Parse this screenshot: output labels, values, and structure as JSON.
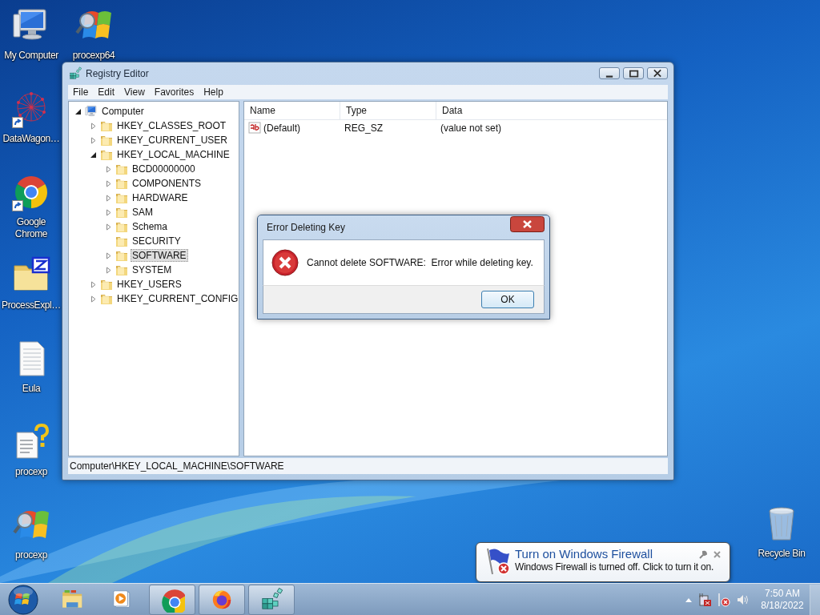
{
  "desktop_icons": [
    {
      "label": "My Computer",
      "kind": "computer",
      "shortcut": false
    },
    {
      "label": "DataWagon…",
      "kind": "network-graph",
      "shortcut": true
    },
    {
      "label": "Google Chrome",
      "kind": "chrome",
      "shortcut": true
    },
    {
      "label": "ProcessExpl…",
      "kind": "zip-folder",
      "shortcut": false
    },
    {
      "label": "Eula",
      "kind": "document",
      "shortcut": false
    },
    {
      "label": "procexp",
      "kind": "help-document",
      "shortcut": false
    },
    {
      "label": "procexp",
      "kind": "windows-magnifier",
      "shortcut": false
    },
    {
      "label": "procexp64",
      "kind": "windows-magnifier",
      "shortcut": false
    }
  ],
  "recycle_bin": {
    "label": "Recycle Bin"
  },
  "registry_editor": {
    "title": "Registry Editor",
    "menu": [
      "File",
      "Edit",
      "View",
      "Favorites",
      "Help"
    ],
    "tree": {
      "label": "Computer",
      "kind": "computer",
      "expandable": true,
      "expanded": true,
      "selected": false,
      "children": [
        {
          "label": "HKEY_CLASSES_ROOT",
          "kind": "folder",
          "expandable": true,
          "expanded": false,
          "selected": false
        },
        {
          "label": "HKEY_CURRENT_USER",
          "kind": "folder",
          "expandable": true,
          "expanded": false,
          "selected": false
        },
        {
          "label": "HKEY_LOCAL_MACHINE",
          "kind": "folder",
          "expandable": true,
          "expanded": true,
          "selected": false,
          "children": [
            {
              "label": "BCD00000000",
              "kind": "folder",
              "expandable": true,
              "expanded": false,
              "selected": false
            },
            {
              "label": "COMPONENTS",
              "kind": "folder",
              "expandable": true,
              "expanded": false,
              "selected": false
            },
            {
              "label": "HARDWARE",
              "kind": "folder",
              "expandable": true,
              "expanded": false,
              "selected": false
            },
            {
              "label": "SAM",
              "kind": "folder",
              "expandable": true,
              "expanded": false,
              "selected": false
            },
            {
              "label": "Schema",
              "kind": "folder",
              "expandable": true,
              "expanded": false,
              "selected": false
            },
            {
              "label": "SECURITY",
              "kind": "folder",
              "expandable": false,
              "selected": false
            },
            {
              "label": "SOFTWARE",
              "kind": "folder",
              "expandable": true,
              "expanded": false,
              "selected": true
            },
            {
              "label": "SYSTEM",
              "kind": "folder",
              "expandable": true,
              "expanded": false,
              "selected": false
            }
          ]
        },
        {
          "label": "HKEY_USERS",
          "kind": "folder",
          "expandable": true,
          "expanded": false,
          "selected": false
        },
        {
          "label": "HKEY_CURRENT_CONFIG",
          "kind": "folder",
          "expandable": true,
          "expanded": false,
          "selected": false
        }
      ]
    },
    "columns": [
      "Name",
      "Type",
      "Data"
    ],
    "rows": [
      {
        "name": "(Default)",
        "type": "REG_SZ",
        "data": "(value not set)"
      }
    ],
    "status_bar": "Computer\\HKEY_LOCAL_MACHINE\\SOFTWARE"
  },
  "error_dialog": {
    "title": "Error Deleting Key",
    "message": "Cannot delete SOFTWARE:  Error while deleting key.",
    "button": "OK"
  },
  "notification": {
    "title": "Turn on Windows Firewall",
    "message": "Windows Firewall is turned off. Click to turn it on."
  },
  "taskbar": {
    "items": [
      {
        "kind": "explorer",
        "running": false
      },
      {
        "kind": "media",
        "running": false
      },
      {
        "kind": "chrome",
        "running": true
      },
      {
        "kind": "firefox",
        "running": true
      },
      {
        "kind": "regedit",
        "running": true
      }
    ],
    "time": "7:50 AM",
    "date": "8/18/2022"
  }
}
